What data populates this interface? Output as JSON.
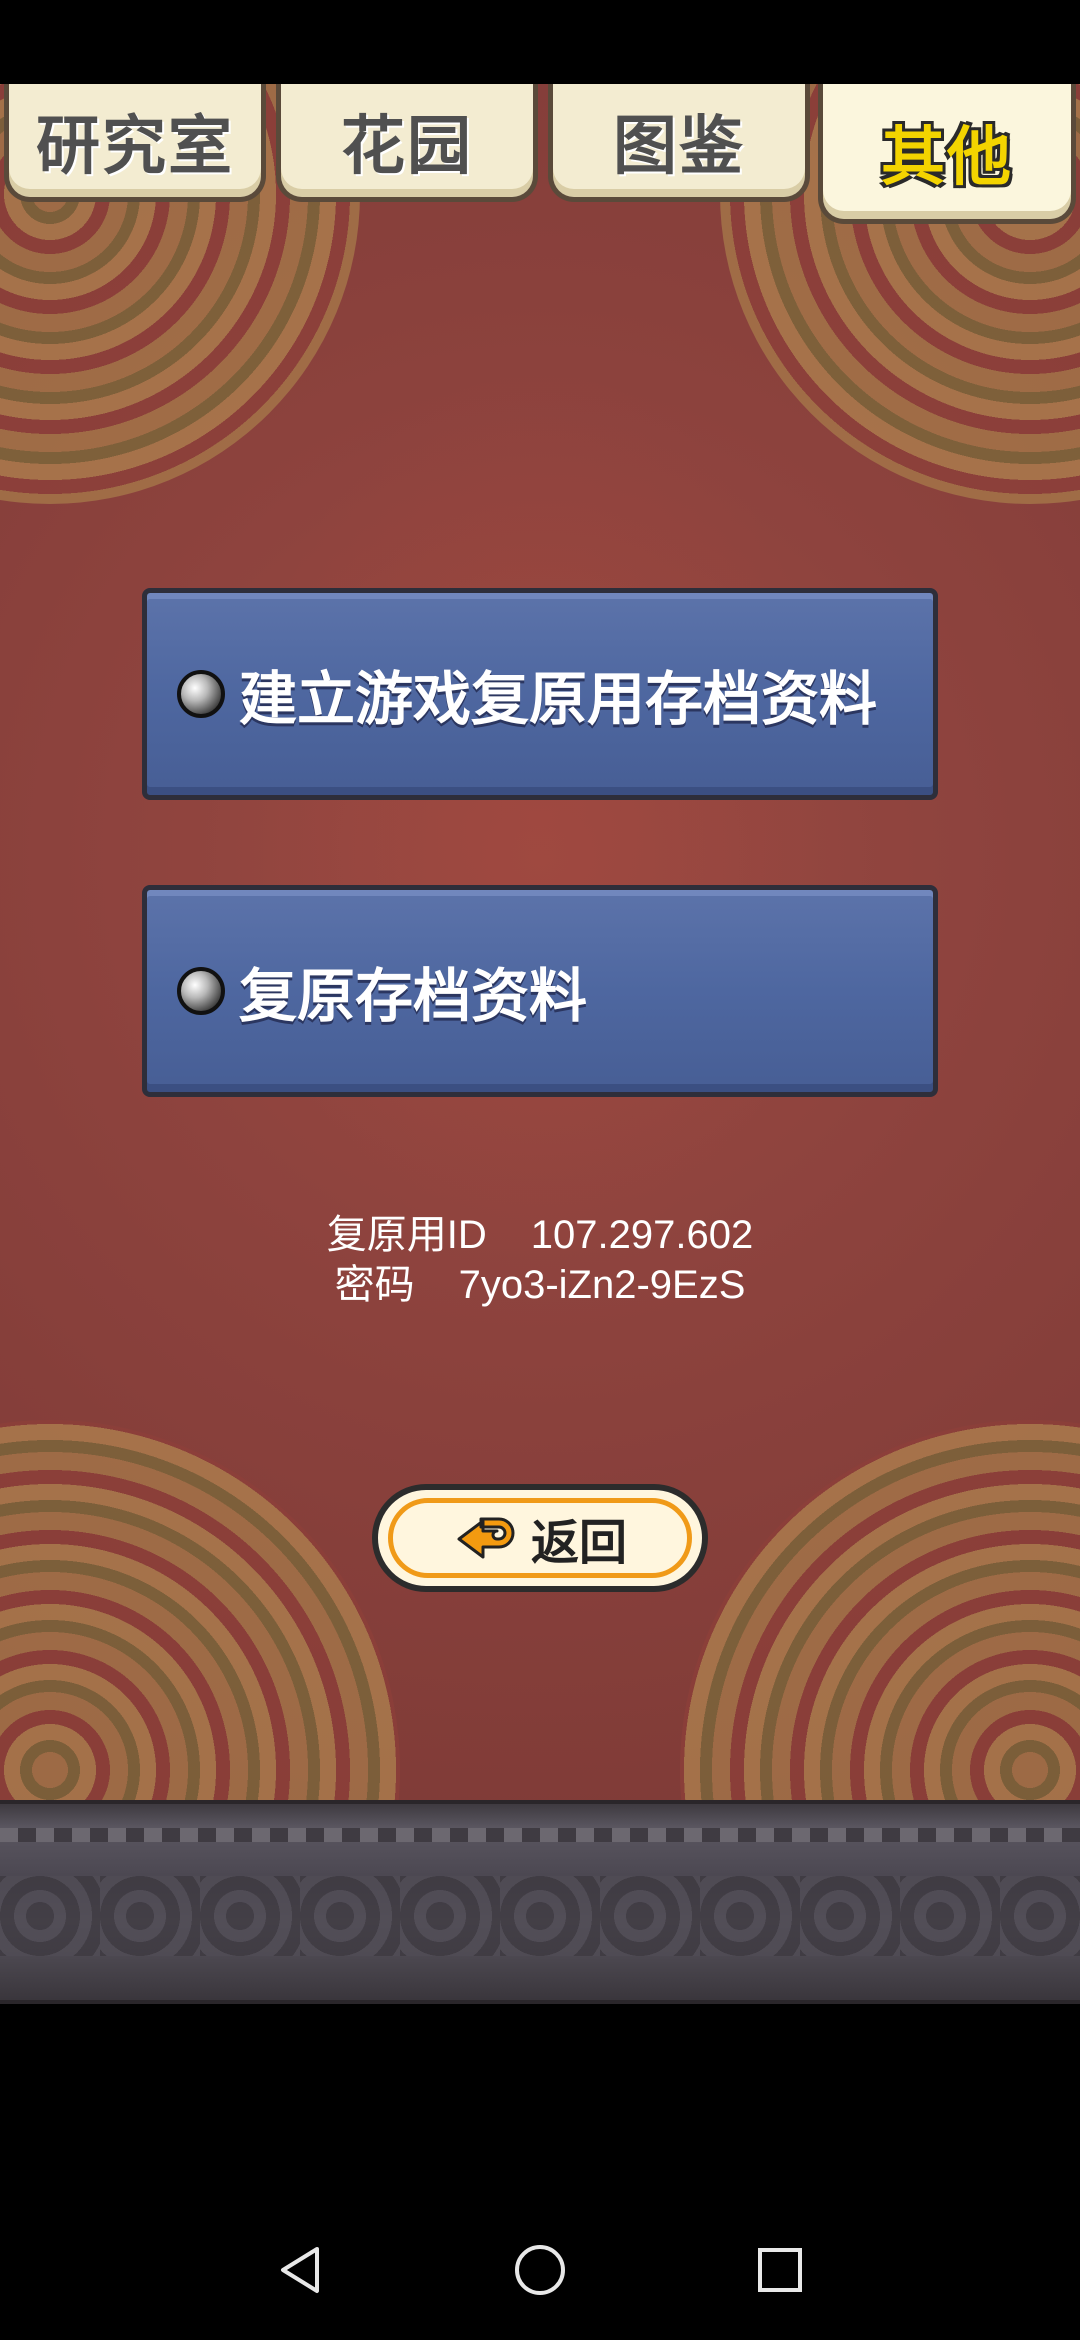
{
  "tabs": [
    {
      "label": "研究室",
      "active": false
    },
    {
      "label": "花园",
      "active": false
    },
    {
      "label": "图鉴",
      "active": false
    },
    {
      "label": "其他",
      "active": true
    }
  ],
  "menu": {
    "create_backup_label": "建立游戏复原用存档资料",
    "restore_backup_label": "复原存档资料"
  },
  "restore_info": {
    "id_label": "复原用ID",
    "id_value": "107.297.602",
    "password_label": "密码",
    "password_value": "7yo3-iZn2-9EzS"
  },
  "back_button": {
    "label": "返回"
  },
  "colors": {
    "background_red": "#8c423d",
    "plank_blue": "#4e67a0",
    "tab_cream": "#f3ecd1",
    "active_tab_text": "#f3d400",
    "back_button_border": "#f09a18"
  },
  "icons": {
    "back_arrow": "back-arrow-icon",
    "nav_back": "triangle-back-icon",
    "nav_home": "circle-home-icon",
    "nav_recent": "square-recent-icon"
  }
}
